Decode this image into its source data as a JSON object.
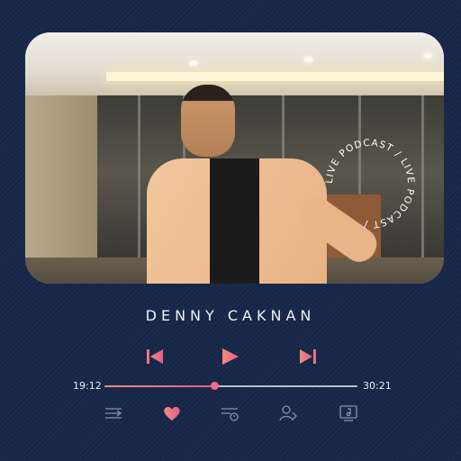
{
  "artist": {
    "name": "DENNY CAKNAN"
  },
  "badge": {
    "text": "LIVE PODCAST / LIVE PODCAST / "
  },
  "player": {
    "current_time": "19:12",
    "total_time": "30:21",
    "progress": 0.434
  },
  "colors": {
    "background": "#172545",
    "accent_start": "#f08c7a",
    "accent_end": "#e35f89",
    "text": "#eef1f7"
  },
  "icons": {
    "controls": [
      "skip-previous-icon",
      "play-icon",
      "skip-next-icon"
    ],
    "bottom": [
      "playlist-icon",
      "heart-icon",
      "queue-timer-icon",
      "user-share-icon",
      "music-note-icon"
    ]
  }
}
